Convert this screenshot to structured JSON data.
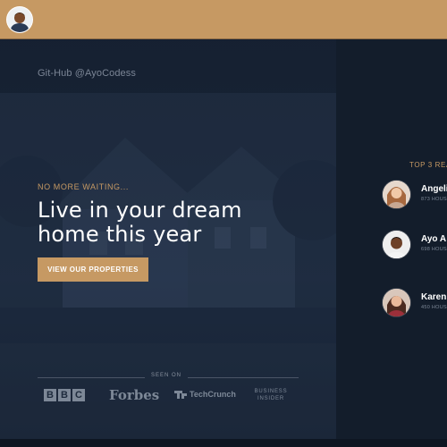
{
  "header": {
    "avatar_icon": "user-avatar-icon",
    "bar_color": "#c69963"
  },
  "hero": {
    "handle": "Git-Hub @AyoCodess",
    "subtitle": "NO MORE WAITING...",
    "headline": "Live in your dream home this year",
    "cta_label": "VIEW OUR PROPERTIES",
    "seen_on_label": "SEEN ON",
    "logos": {
      "bbc": [
        "B",
        "B",
        "C"
      ],
      "forbes": "Forbes",
      "techcrunch": "TechCrunch",
      "business_insider": "BUSINESS INSIDER"
    }
  },
  "realtors": {
    "title": "TOP 3 REA",
    "items": [
      {
        "name": "Angeli",
        "houses": "873 HOUS"
      },
      {
        "name": "Ayo A",
        "houses": "698 HOUS"
      },
      {
        "name": "Karen",
        "houses": "450 HOUS"
      }
    ]
  },
  "colors": {
    "accent": "#c69963",
    "panel": "#131d2b",
    "hero_overlay": "#1b283c"
  }
}
